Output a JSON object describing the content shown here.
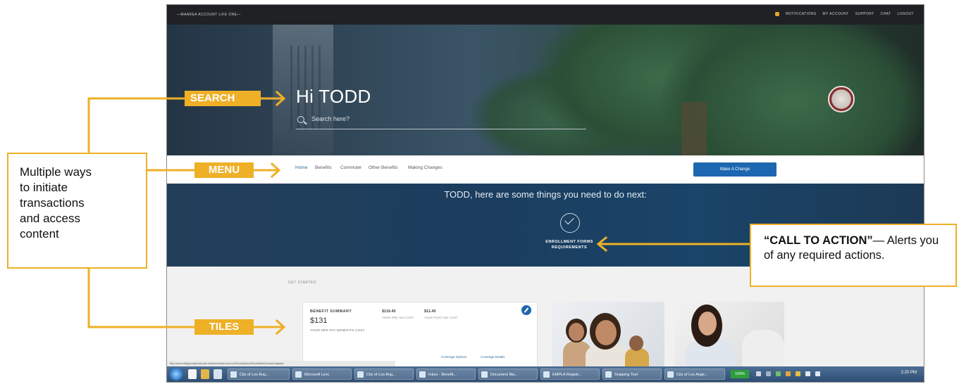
{
  "topbar": {
    "site": "—MAAREA ACCOUNT LIFE ONE—",
    "links": [
      "NOTIFICATIONS",
      "MY ACCOUNT",
      "SUPPORT",
      "CHAT",
      "LOGOUT"
    ]
  },
  "hero": {
    "greeting": "Hi TODD",
    "search_placeholder": "Search here?"
  },
  "menu": {
    "items": [
      "Home",
      "Benefits",
      "Commuter",
      "Other Benefits",
      "Making Changes"
    ],
    "make_change": "Make A Change"
  },
  "cta": {
    "message": "TODD, here are some things you need to do next:",
    "label": "ENROLLMENT FORMS\nREQUIREMENTS"
  },
  "content": {
    "section_label": "GET STARTED",
    "benefit_summary": {
      "title": "BENEFIT SUMMARY",
      "total": "$131",
      "total_caption": "YOUR PER PAY BENEFITS COST",
      "pre_tax_amount": "$119.45",
      "pre_tax_label": "YOUR PRE-TAX COST",
      "post_tax_amount": "$11.40",
      "post_tax_label": "YOUR POST-TAX COST",
      "link_options": "Coverage Options",
      "link_details": "Coverage Details"
    }
  },
  "status_url": "http://cms.ellegrompetofor.sat.mimaexshearcom.m/h?tools/AcceslTools/MhDocumentfyptae",
  "taskbar": {
    "buttons": [
      "City of Los Ang...",
      "Microsoft Lync",
      "City of Los Ang...",
      "Inbox - Benefit...",
      "Document Ma...",
      "EMPLA Registr...",
      "Snipping Tool",
      "City of Los Ange..."
    ],
    "zoom": "100%",
    "clock": "2:20 PM"
  },
  "annotations": {
    "left_note": "Multiple ways\nto initiate\ntransactions\nand access\ncontent",
    "search_tag": "SEARCH",
    "menu_tag": "MENU",
    "tiles_tag": "TILES",
    "cta_heading": "“CALL TO ACTION”",
    "cta_dash": "—",
    "cta_body": "Alerts you of any required actions.",
    "accent_color": "#eeb027"
  }
}
